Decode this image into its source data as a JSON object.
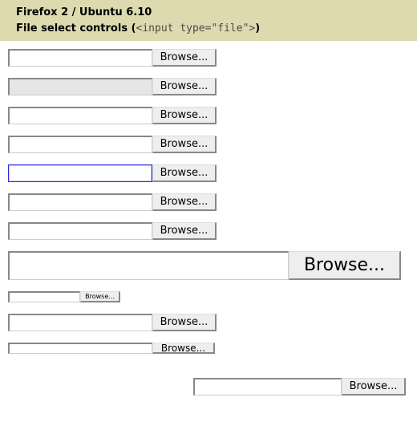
{
  "header": {
    "title": "Firefox 2 / Ubuntu 6.10",
    "subtitle_prefix": "File select controls (",
    "subtitle_code": "<input type=\"file\">",
    "subtitle_suffix": ")"
  },
  "browse_label": "Browse..."
}
